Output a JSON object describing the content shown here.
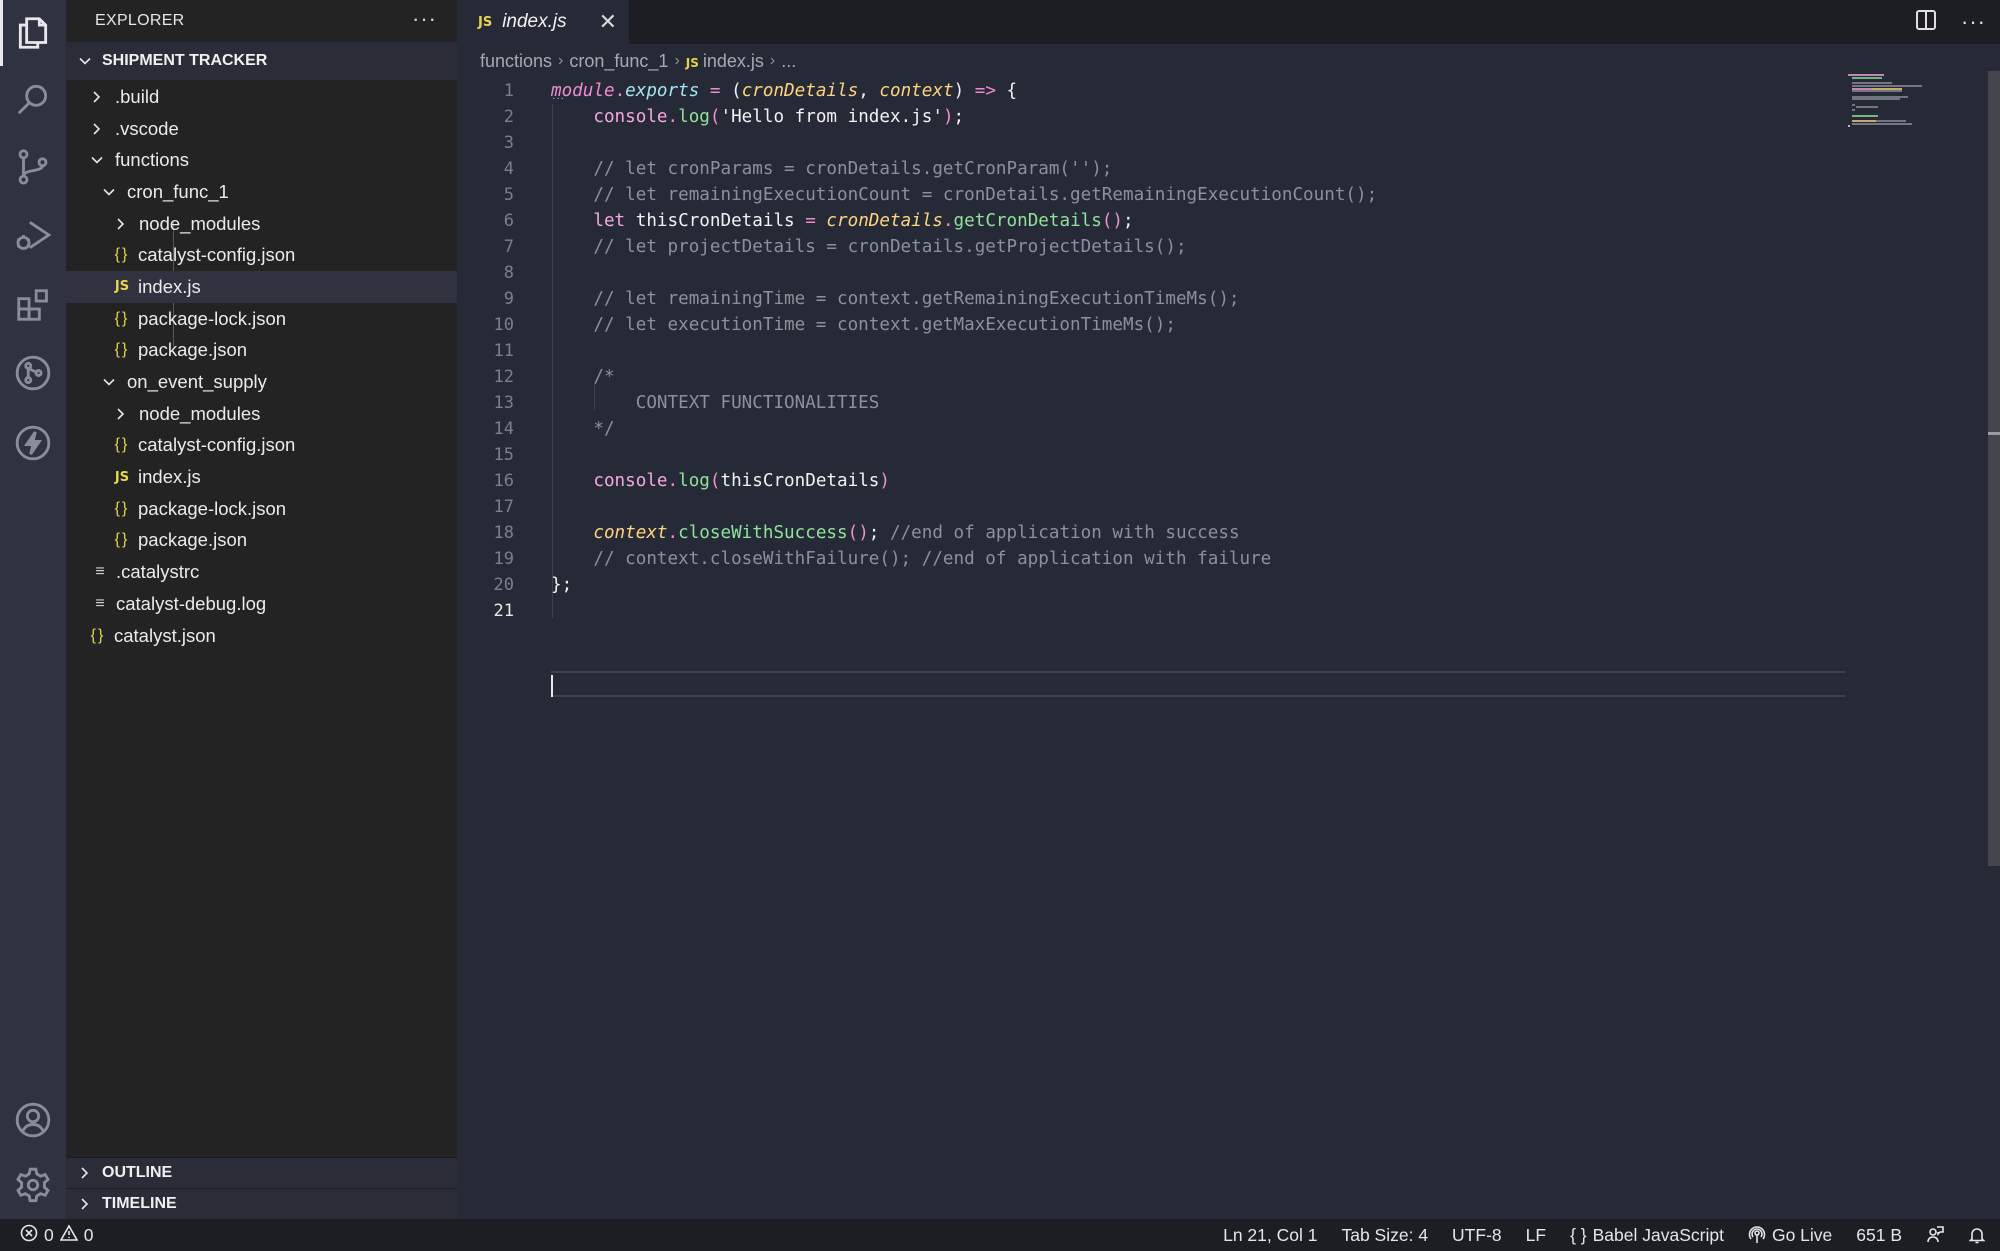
{
  "activity_bar": {
    "items": [
      {
        "name": "explorer",
        "icon": "files-icon",
        "active": true
      },
      {
        "name": "search",
        "icon": "search-icon",
        "active": false
      },
      {
        "name": "source-control",
        "icon": "source-control-icon",
        "active": false
      },
      {
        "name": "run-debug",
        "icon": "run-debug-icon",
        "active": false
      },
      {
        "name": "extensions",
        "icon": "extensions-icon",
        "active": false
      },
      {
        "name": "git-graph",
        "icon": "git-graph-icon",
        "active": false
      },
      {
        "name": "catalyst",
        "icon": "lightning-icon",
        "active": false
      }
    ],
    "bottom": [
      {
        "name": "accounts",
        "icon": "account-icon"
      },
      {
        "name": "manage",
        "icon": "gear-icon"
      }
    ]
  },
  "sidebar": {
    "title": "EXPLORER",
    "more": "···",
    "workspace": "SHIPMENT TRACKER",
    "tree": [
      {
        "label": ".build",
        "type": "folder",
        "expanded": false,
        "depth": 1
      },
      {
        "label": ".vscode",
        "type": "folder",
        "expanded": false,
        "depth": 1
      },
      {
        "label": "functions",
        "type": "folder",
        "expanded": true,
        "depth": 1
      },
      {
        "label": "cron_func_1",
        "type": "folder",
        "expanded": true,
        "depth": 2
      },
      {
        "label": "node_modules",
        "type": "folder",
        "expanded": false,
        "depth": 3
      },
      {
        "label": "catalyst-config.json",
        "type": "json",
        "depth": 3
      },
      {
        "label": "index.js",
        "type": "js",
        "depth": 3,
        "selected": true
      },
      {
        "label": "package-lock.json",
        "type": "json",
        "depth": 3
      },
      {
        "label": "package.json",
        "type": "json",
        "depth": 3
      },
      {
        "label": "on_event_supply",
        "type": "folder",
        "expanded": true,
        "depth": 2
      },
      {
        "label": "node_modules",
        "type": "folder",
        "expanded": false,
        "depth": 3
      },
      {
        "label": "catalyst-config.json",
        "type": "json",
        "depth": 3
      },
      {
        "label": "index.js",
        "type": "js",
        "depth": 3
      },
      {
        "label": "package-lock.json",
        "type": "json",
        "depth": 3
      },
      {
        "label": "package.json",
        "type": "json",
        "depth": 3
      },
      {
        "label": ".catalystrc",
        "type": "text",
        "depth": 1
      },
      {
        "label": "catalyst-debug.log",
        "type": "text",
        "depth": 1
      },
      {
        "label": "catalyst.json",
        "type": "json",
        "depth": 0
      }
    ],
    "sections": [
      "OUTLINE",
      "TIMELINE"
    ]
  },
  "tabs": [
    {
      "label": "index.js",
      "badge": "JS",
      "active": true,
      "close": "✕"
    }
  ],
  "breadcrumb": {
    "items": [
      "functions",
      "cron_func_1",
      "index.js",
      "..."
    ],
    "badge": "JS",
    "separator": "›"
  },
  "editor": {
    "current_line": 21,
    "lines": [
      {
        "n": "1"
      },
      {
        "n": "2"
      },
      {
        "n": "3"
      },
      {
        "n": "4"
      },
      {
        "n": "5"
      },
      {
        "n": "6"
      },
      {
        "n": "7"
      },
      {
        "n": "8"
      },
      {
        "n": "9"
      },
      {
        "n": "10"
      },
      {
        "n": "11"
      },
      {
        "n": "12"
      },
      {
        "n": "13"
      },
      {
        "n": "14"
      },
      {
        "n": "15"
      },
      {
        "n": "16"
      },
      {
        "n": "17"
      },
      {
        "n": "18"
      },
      {
        "n": "19"
      },
      {
        "n": "20"
      },
      {
        "n": "21"
      }
    ],
    "tokens": {
      "l1": {
        "module": "module",
        "dot": ".",
        "exports": "exports",
        "eq": " = ",
        "open": "(",
        "p1": "cronDetails",
        "comma": ", ",
        "p2": "context",
        "close": ")",
        "arrow": " => ",
        "brace": "{"
      },
      "l2": {
        "indent": "    ",
        "console": "console",
        "dot": ".",
        "log": "log",
        "open": "(",
        "str": "'Hello from index.js'",
        "close": ")",
        "semi": ";"
      },
      "l4": "    // let cronParams = cronDetails.getCronParam('');",
      "l5": "    // let remainingExecutionCount = cronDetails.getRemainingExecutionCount();",
      "l6": {
        "indent": "    ",
        "let": "let",
        "var": " thisCronDetails ",
        "eq": "= ",
        "obj": "cronDetails",
        "dot": ".",
        "fn": "getCronDetails",
        "parens": "()",
        "semi": ";"
      },
      "l7": "    // let projectDetails = cronDetails.getProjectDetails();",
      "l9": "    // let remainingTime = context.getRemainingExecutionTimeMs();",
      "l10": "    // let executionTime = context.getMaxExecutionTimeMs();",
      "l12": "    /*",
      "l13": "        CONTEXT FUNCTIONALITIES",
      "l14": "    */",
      "l16": {
        "indent": "    ",
        "console": "console",
        "dot": ".",
        "log": "log",
        "open": "(",
        "arg": "thisCronDetails",
        "close": ")"
      },
      "l18": {
        "indent": "    ",
        "obj": "context",
        "dot": ".",
        "fn": "closeWithSuccess",
        "parens": "()",
        "semi": "; ",
        "comment": "//end of application with success"
      },
      "l19": "    // context.closeWithFailure(); //end of application with failure",
      "l20": "};"
    }
  },
  "statusbar": {
    "errors": "0",
    "warnings": "0",
    "position": "Ln 21, Col 1",
    "tab_size": "Tab Size: 4",
    "encoding": "UTF-8",
    "eol": "LF",
    "language_icon": "{ }",
    "language": "Babel JavaScript",
    "go_live": "Go Live",
    "file_size": "651 B"
  },
  "colors": {
    "editor_bg": "#262a37",
    "sidebar_bg": "#232323",
    "activity_bg": "#2f3241",
    "statusbar_bg": "#1d1e24",
    "js_badge": "#e8d44d",
    "keyword": "#f7a8e0",
    "property": "#a3e5f1",
    "parameter": "#ffd480",
    "function": "#8fe39b",
    "comment": "#8d909b"
  }
}
